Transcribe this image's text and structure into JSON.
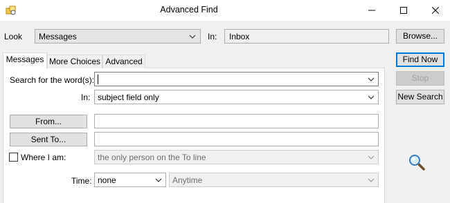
{
  "window": {
    "title": "Advanced Find",
    "icon": "advanced-find-app-icon",
    "minimize_icon": "minimize-icon",
    "maximize_icon": "maximize-icon",
    "close_icon": "close-icon"
  },
  "look": {
    "label": "Look",
    "selected": "Messages",
    "in_label": "In:",
    "in_value": "Inbox"
  },
  "buttons": {
    "browse": "Browse...",
    "find_now": "Find Now",
    "stop": "Stop",
    "new_search": "New Search"
  },
  "tabs": [
    {
      "label": "Messages",
      "active": true
    },
    {
      "label": "More Choices",
      "active": false
    },
    {
      "label": "Advanced",
      "active": false
    }
  ],
  "messages_tab": {
    "search_label": "Search for the word(s):",
    "search_value": "",
    "in_label": "In:",
    "in_value": "subject field only",
    "from_button": "From...",
    "from_value": "",
    "sent_to_button": "Sent To...",
    "sent_to_value": "",
    "where_i_am_label": "Where I am:",
    "where_i_am_checked": false,
    "where_i_am_value": "the only person on the To line",
    "time_label": "Time:",
    "time_value": "none",
    "time_range_value": "Anytime"
  },
  "search_graphic": "magnifier-icon",
  "colors": {
    "accent": "#0078d7",
    "panel_bg": "#ffffff",
    "window_bg": "#f0f0f0"
  }
}
